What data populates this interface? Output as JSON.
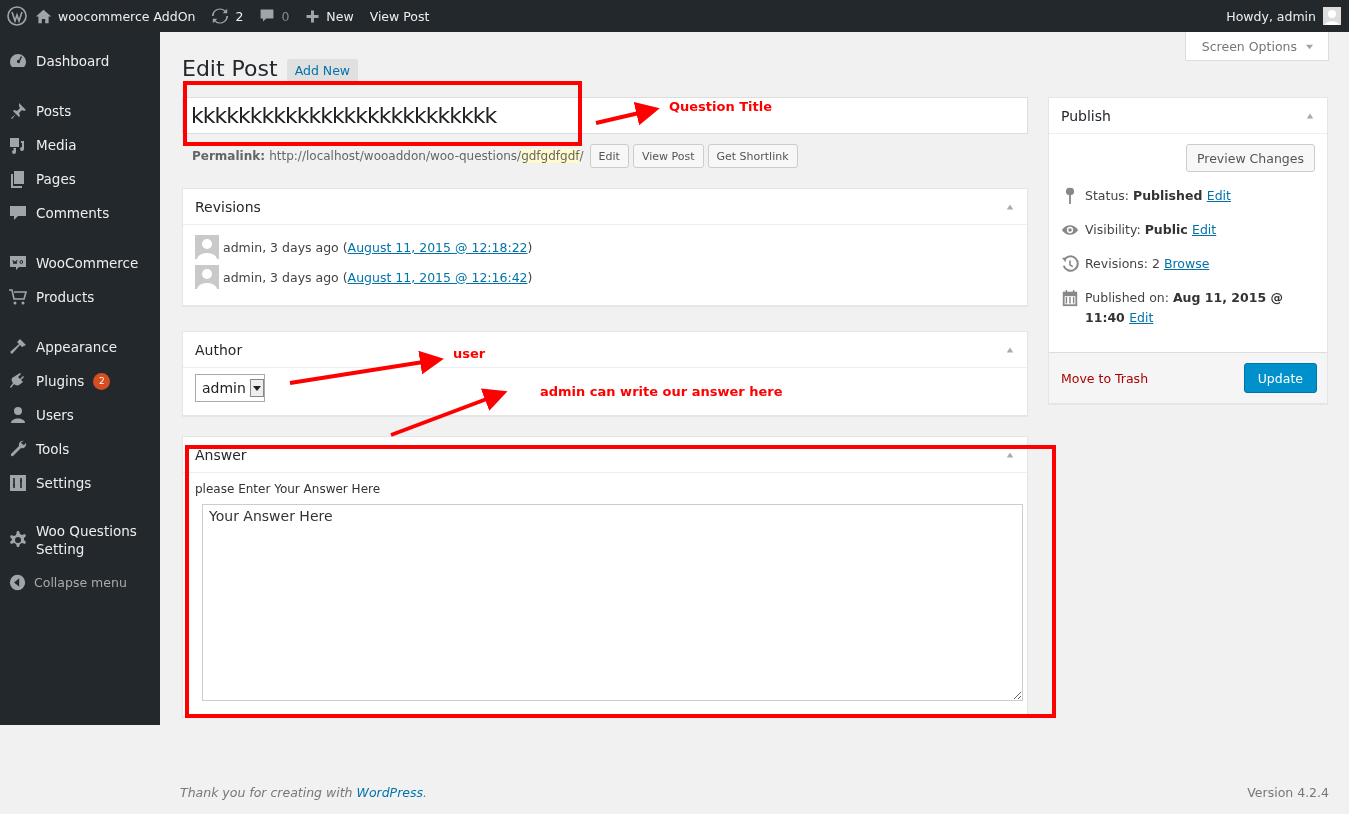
{
  "admin_bar": {
    "site": "woocommerce AddOn",
    "updates": "2",
    "comments": "0",
    "new": "New",
    "view": "View Post",
    "howdy": "Howdy, admin"
  },
  "sidebar": {
    "groups": [
      [
        {
          "label": "Dashboard",
          "selected": false
        }
      ],
      [
        {
          "label": "Posts",
          "selected": false
        },
        {
          "label": "Media",
          "selected": false
        },
        {
          "label": "Pages",
          "selected": false
        },
        {
          "label": "Comments",
          "selected": false
        }
      ],
      [
        {
          "label": "WooCommerce",
          "selected": false
        },
        {
          "label": "Products",
          "selected": false
        }
      ],
      [
        {
          "label": "Appearance",
          "selected": false
        },
        {
          "label": "Plugins",
          "selected": false,
          "badge": "2"
        },
        {
          "label": "Users",
          "selected": false
        },
        {
          "label": "Tools",
          "selected": false
        },
        {
          "label": "Settings",
          "selected": false
        }
      ],
      [
        {
          "label": "Woo Questions Setting",
          "selected": false
        }
      ]
    ],
    "collapse": "Collapse menu"
  },
  "screen_options": "Screen Options",
  "heading": "Edit Post",
  "add_new": "Add New",
  "title_value": "kkkkkkkkkkkkkkkkkkkkkkkkkk",
  "permalink": {
    "label": "Permalink:",
    "url": "http://localhost/wooaddon/woo-questions/",
    "slug": "gdfgdfgdf",
    "tail": "/",
    "buttons": [
      "Edit",
      "View Post",
      "Get Shortlink"
    ]
  },
  "revisions": {
    "title": "Revisions",
    "rows": [
      {
        "text": "admin, 3 days ago (",
        "link": "August 11, 2015 @ 12:18:22",
        "end": ")"
      },
      {
        "text": "admin, 3 days ago (",
        "link": "August 11, 2015 @ 12:16:42",
        "end": ")"
      }
    ]
  },
  "author": {
    "title": "Author",
    "value": "admin"
  },
  "answer": {
    "title": "Answer",
    "label": "please Enter Your Answer Here",
    "value": "Your Answer Here"
  },
  "publish": {
    "title": "Publish",
    "preview": "Preview Changes",
    "rows": [
      {
        "label": "Status:",
        "value": "Published",
        "link": "Edit"
      },
      {
        "label": "Visibility:",
        "value": "Public",
        "link": "Edit"
      },
      {
        "label": "Revisions: 2",
        "value": "",
        "link": "Browse"
      },
      {
        "label": "Published on:",
        "value": "Aug 11, 2015 @ 11:40",
        "link": "Edit"
      }
    ],
    "trash": "Move to Trash",
    "update": "Update"
  },
  "annotations": [
    "Question Title",
    "user",
    "admin can write our answer here"
  ],
  "footer": {
    "thanks": "Thank you for creating with ",
    "link": "WordPress",
    "dot": ".",
    "version": "Version 4.2.4"
  }
}
